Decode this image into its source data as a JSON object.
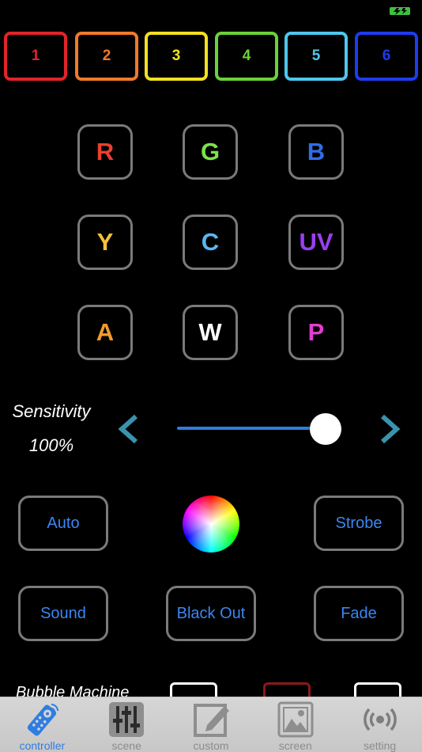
{
  "status": {
    "battery_icon": "battery-charging-icon",
    "battery_color": "#3fbf3f"
  },
  "zones": [
    {
      "label": "1",
      "color": "#e0242a"
    },
    {
      "label": "2",
      "color": "#f07a2a"
    },
    {
      "label": "3",
      "color": "#f5e022"
    },
    {
      "label": "4",
      "color": "#6ad23a"
    },
    {
      "label": "5",
      "color": "#4ec7ec"
    },
    {
      "label": "6",
      "color": "#1e3cf0"
    }
  ],
  "colors": [
    {
      "label": "R",
      "color": "#e8402f"
    },
    {
      "label": "G",
      "color": "#7ee24a"
    },
    {
      "label": "B",
      "color": "#2f6de8"
    },
    {
      "label": "Y",
      "color": "#f2c23a"
    },
    {
      "label": "C",
      "color": "#5bb6f0"
    },
    {
      "label": "UV",
      "color": "#9a3ff0"
    },
    {
      "label": "A",
      "color": "#f39a2c"
    },
    {
      "label": "W",
      "color": "#ffffff"
    },
    {
      "label": "P",
      "color": "#df3fd2"
    }
  ],
  "sensitivity": {
    "label": "Sensitivity",
    "value_text": "100%",
    "value": 1.0,
    "accent": "#2f7de1",
    "arrow_color": "#3a93ac"
  },
  "modes": {
    "auto": "Auto",
    "strobe": "Strobe",
    "sound": "Sound",
    "blackout": "Black Out",
    "fade": "Fade",
    "text_color": "#3b86f2"
  },
  "bubble": {
    "label": "Bubble Machine",
    "button_colors": [
      "#ffffff",
      "#8b1a1a",
      "#ffffff"
    ]
  },
  "tabs": [
    {
      "label": "controller",
      "icon": "remote-icon",
      "active": true
    },
    {
      "label": "scene",
      "icon": "sliders-icon",
      "active": false
    },
    {
      "label": "custom",
      "icon": "edit-icon",
      "active": false
    },
    {
      "label": "screen",
      "icon": "picture-icon",
      "active": false
    },
    {
      "label": "setting",
      "icon": "broadcast-icon",
      "active": false
    }
  ]
}
